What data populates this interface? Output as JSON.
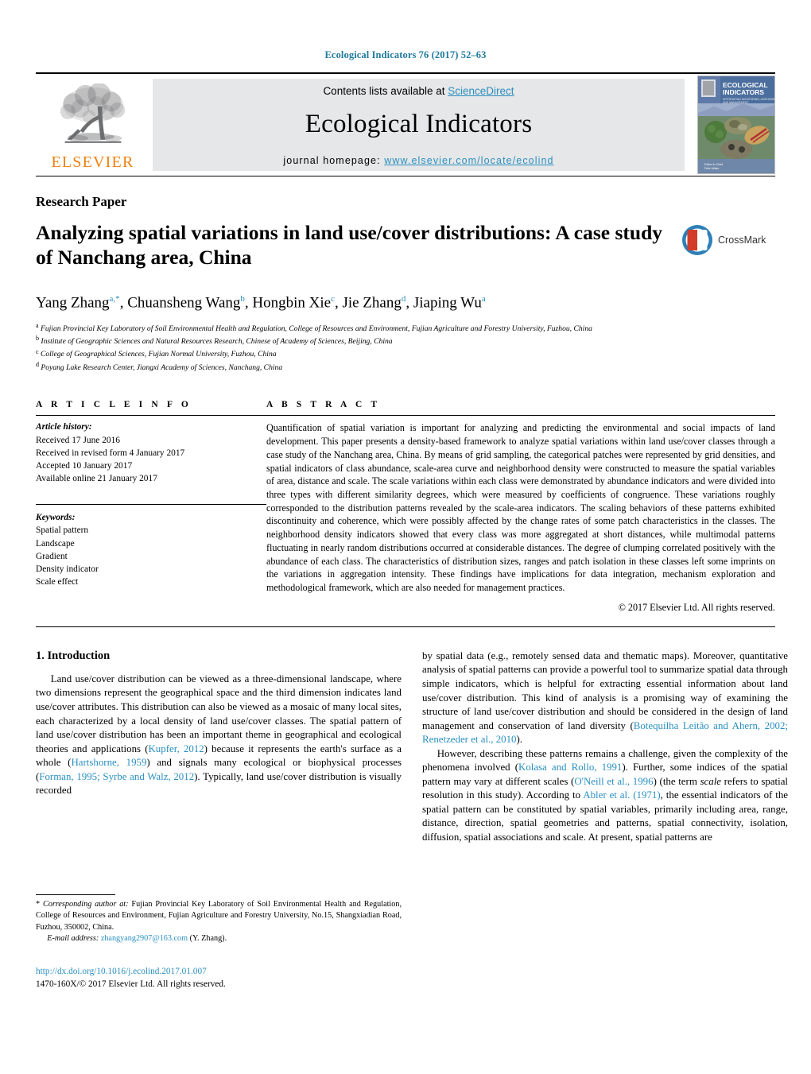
{
  "running_head": "Ecological Indicators 76 (2017) 52–63",
  "masthead": {
    "publisher_name": "ELSEVIER",
    "contents_prefix": "Contents lists available at ",
    "contents_link": "ScienceDirect",
    "journal_title": "Ecological Indicators",
    "homepage_prefix": "journal homepage: ",
    "homepage_url": "www.elsevier.com/locate/ecolind",
    "cover_title_line1": "ECOLOGICAL",
    "cover_title_line2": "INDICATORS",
    "cover_subtitle": "INTEGRATING MONITORING, ASSESSMENT AND MANAGEMENT"
  },
  "article": {
    "kind": "Research Paper",
    "title": "Analyzing spatial variations in land use/cover distributions: A case study of Nanchang area, China",
    "crossmark_label": "CrossMark",
    "authors_html": "Yang Zhang<sup>a,*</sup>, Chuansheng Wang<sup>b</sup>, Hongbin Xie<sup>c</sup>, Jie Zhang<sup>d</sup>, Jiaping Wu<sup>a</sup>",
    "affiliations": [
      {
        "mark": "a",
        "text": "Fujian Provincial Key Laboratory of Soil Environmental Health and Regulation, College of Resources and Environment, Fujian Agriculture and Forestry University, Fuzhou, China"
      },
      {
        "mark": "b",
        "text": "Institute of Geographic Sciences and Natural Resources Research, Chinese of Academy of Sciences, Beijing, China"
      },
      {
        "mark": "c",
        "text": "College of Geographical Sciences, Fujian Normal University, Fuzhou, China"
      },
      {
        "mark": "d",
        "text": "Poyang Lake Research Center, Jiangxi Academy of Sciences, Nanchang, China"
      }
    ]
  },
  "article_info": {
    "heading": "A R T I C L E   I N F O",
    "history_label": "Article history:",
    "history": [
      "Received 17 June 2016",
      "Received in revised form 4 January 2017",
      "Accepted 10 January 2017",
      "Available online 21 January 2017"
    ],
    "keywords_label": "Keywords:",
    "keywords": [
      "Spatial pattern",
      "Landscape",
      "Gradient",
      "Density indicator",
      "Scale effect"
    ]
  },
  "abstract": {
    "heading": "A B S T R A C T",
    "text": "Quantification of spatial variation is important for analyzing and predicting the environmental and social impacts of land development. This paper presents a density-based framework to analyze spatial variations within land use/cover classes through a case study of the Nanchang area, China. By means of grid sampling, the categorical patches were represented by grid densities, and spatial indicators of class abundance, scale-area curve and neighborhood density were constructed to measure the spatial variables of area, distance and scale. The scale variations within each class were demonstrated by abundance indicators and were divided into three types with different similarity degrees, which were measured by coefficients of congruence. These variations roughly corresponded to the distribution patterns revealed by the scale-area indicators. The scaling behaviors of these patterns exhibited discontinuity and coherence, which were possibly affected by the change rates of some patch characteristics in the classes. The neighborhood density indicators showed that every class was more aggregated at short distances, while multimodal patterns fluctuating in nearly random distributions occurred at considerable distances. The degree of clumping correlated positively with the abundance of each class. The characteristics of distribution sizes, ranges and patch isolation in these classes left some imprints on the variations in aggregation intensity. These findings have implications for data integration, mechanism exploration and methodological framework, which are also needed for management practices.",
    "copyright": "© 2017 Elsevier Ltd. All rights reserved."
  },
  "introduction": {
    "heading": "1.  Introduction",
    "left_p1_html": "Land use/cover distribution can be viewed as a three-dimensional landscape, where two dimensions represent the geographical space and the third dimension indicates land use/cover attributes. This distribution can also be viewed as a mosaic of many local sites, each characterized by a local density of land use/cover classes. The spatial pattern of land use/cover distribution has been an important theme in geographical and ecological theories and applications (<span class=\"ref\">Kupfer, 2012</span>) because it represents the earth's surface as a whole (<span class=\"ref\">Hartshorne, 1959</span>) and signals many ecological or biophysical processes (<span class=\"ref\">Forman, 1995; Syrbe and Walz, 2012</span>). Typically, land use/cover distribution is visually recorded",
    "right_p1_html": "by spatial data (e.g., remotely sensed data and thematic maps). Moreover, quantitative analysis of spatial patterns can provide a powerful tool to summarize spatial data through simple indicators, which is helpful for extracting essential information about land use/cover distribution. This kind of analysis is a promising way of examining the structure of land use/cover distribution and should be considered in the design of land management and conservation of land diversity (<span class=\"ref\">Botequilha Leitão and Ahern, 2002; Renetzeder et al., 2010</span>).",
    "right_p2_html": "However, describing these patterns remains a challenge, given the complexity of the phenomena involved (<span class=\"ref\">Kolasa and Rollo, 1991</span>). Further, some indices of the spatial pattern may vary at different scales (<span class=\"ref\">O'Neill et al., 1996</span>) (the term <span class=\"it\">scale</span> refers to spatial resolution in this study). According to <span class=\"ref\">Abler et al. (1971)</span>, the essential indicators of the spatial pattern can be constituted by spatial variables, primarily including area, range, distance, direction, spatial geometries and patterns, spatial connectivity, isolation, diffusion, spatial associations and scale. At present, spatial patterns are"
  },
  "footnote": {
    "corresponding_html": "* <span class=\"it\">Corresponding author at:</span> Fujian Provincial Key Laboratory of Soil Environmental Health and Regulation, College of Resources and Environment, Fujian Agriculture and Forestry University, No.15, Shangxiadian Road, Fuzhou, 350002, China.",
    "email_label": "E-mail address:",
    "email": "zhangyang2907@163.com",
    "email_suffix": "(Y. Zhang).",
    "doi": "http://dx.doi.org/10.1016/j.ecolind.2017.01.007",
    "issn_line": "1470-160X/© 2017 Elsevier Ltd. All rights reserved."
  },
  "colors": {
    "link": "#2a8fc0",
    "elsevier_orange": "#f08010",
    "running_head": "#1f7a9e"
  }
}
